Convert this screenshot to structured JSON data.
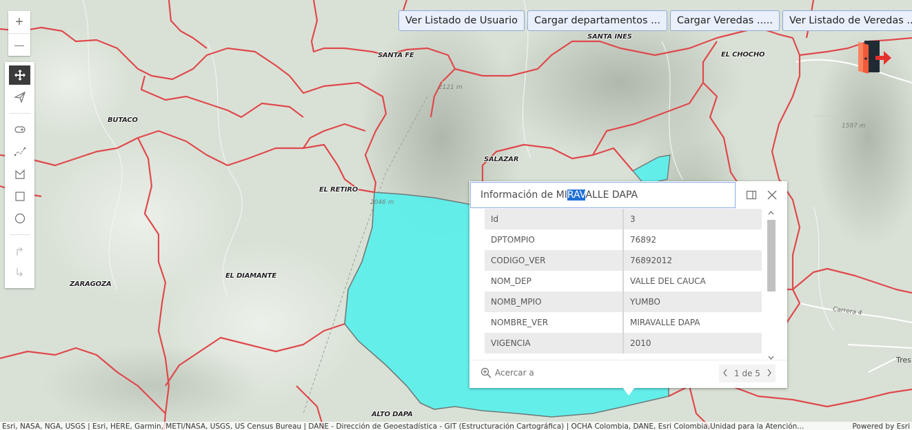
{
  "zoom": {
    "in_label": "+",
    "out_label": "—"
  },
  "tools": [
    {
      "name": "pan-tool",
      "icon": "move-icon",
      "active": true
    },
    {
      "name": "navigate-tool",
      "icon": "paper-plane-icon",
      "active": false
    },
    {
      "name": "point-tool",
      "icon": "point-icon",
      "active": false
    },
    {
      "name": "polyline-tool",
      "icon": "polyline-icon",
      "active": false
    },
    {
      "name": "polygon-tool",
      "icon": "polygon-icon",
      "active": false
    },
    {
      "name": "rectangle-tool",
      "icon": "rectangle-icon",
      "active": false
    },
    {
      "name": "circle-tool",
      "icon": "circle-icon",
      "active": false
    },
    {
      "name": "undo-tool",
      "icon": "undo-icon",
      "active": false
    },
    {
      "name": "redo-tool",
      "icon": "redo-icon",
      "active": false
    }
  ],
  "top_buttons": [
    "Ver Listado de Usuario",
    "Cargar departamentos ...",
    "Cargar Veredas .....",
    "Ver Listado de Veredas ...."
  ],
  "map_labels": {
    "santa_ines": "SANTA INES",
    "santa_fe": "SANTA FE",
    "el_chocho": "EL CHOCHO",
    "butaco": "BUTACO",
    "salazar": "SALAZAR",
    "el_retiro": "EL RETIRO",
    "el_diamante": "EL DIAMANTE",
    "zaragoza": "ZARAGOZA",
    "alto_dapa": "ALTO DAPA",
    "carrera_4": "Carrera 4",
    "tres": "Tres",
    "elev_2121": "2121 m",
    "elev_1597": "1597 m",
    "elev_2046": "2046 m"
  },
  "popup": {
    "title_before": "Información de MI",
    "title_selected": "RAV",
    "title_after": "ALLE DAPA",
    "dock_icon": "dock-icon",
    "close_icon": "close-icon",
    "attributes": [
      {
        "key": "Id",
        "value": "3"
      },
      {
        "key": "DPTOMPIO",
        "value": "76892"
      },
      {
        "key": "CODIGO_VER",
        "value": "76892012"
      },
      {
        "key": "NOM_DEP",
        "value": "VALLE DEL CAUCA"
      },
      {
        "key": "NOMB_MPIO",
        "value": "YUMBO"
      },
      {
        "key": "NOMBRE_VER",
        "value": "MIRAVALLE DAPA"
      },
      {
        "key": "VIGENCIA",
        "value": "2010"
      }
    ],
    "zoom_to_label": "Acercar a",
    "pager_text": "1 de 5"
  },
  "attribution": {
    "sources": "Esri, NASA, NGA, USGS | Esri, HERE, Garmin, METI/NASA, USGS, US Census Bureau | DANE - Dirección de Geoestadística - GIT (Estructuración Cartográfica) | OCHA Colombia, DANE, Esri Colombia,Unidad para la Atención...",
    "powered_by": "Powered by Esri"
  },
  "colors": {
    "selected_fill": "#56f0ec",
    "boundary": "#e0484c",
    "road": "#ffffff"
  }
}
